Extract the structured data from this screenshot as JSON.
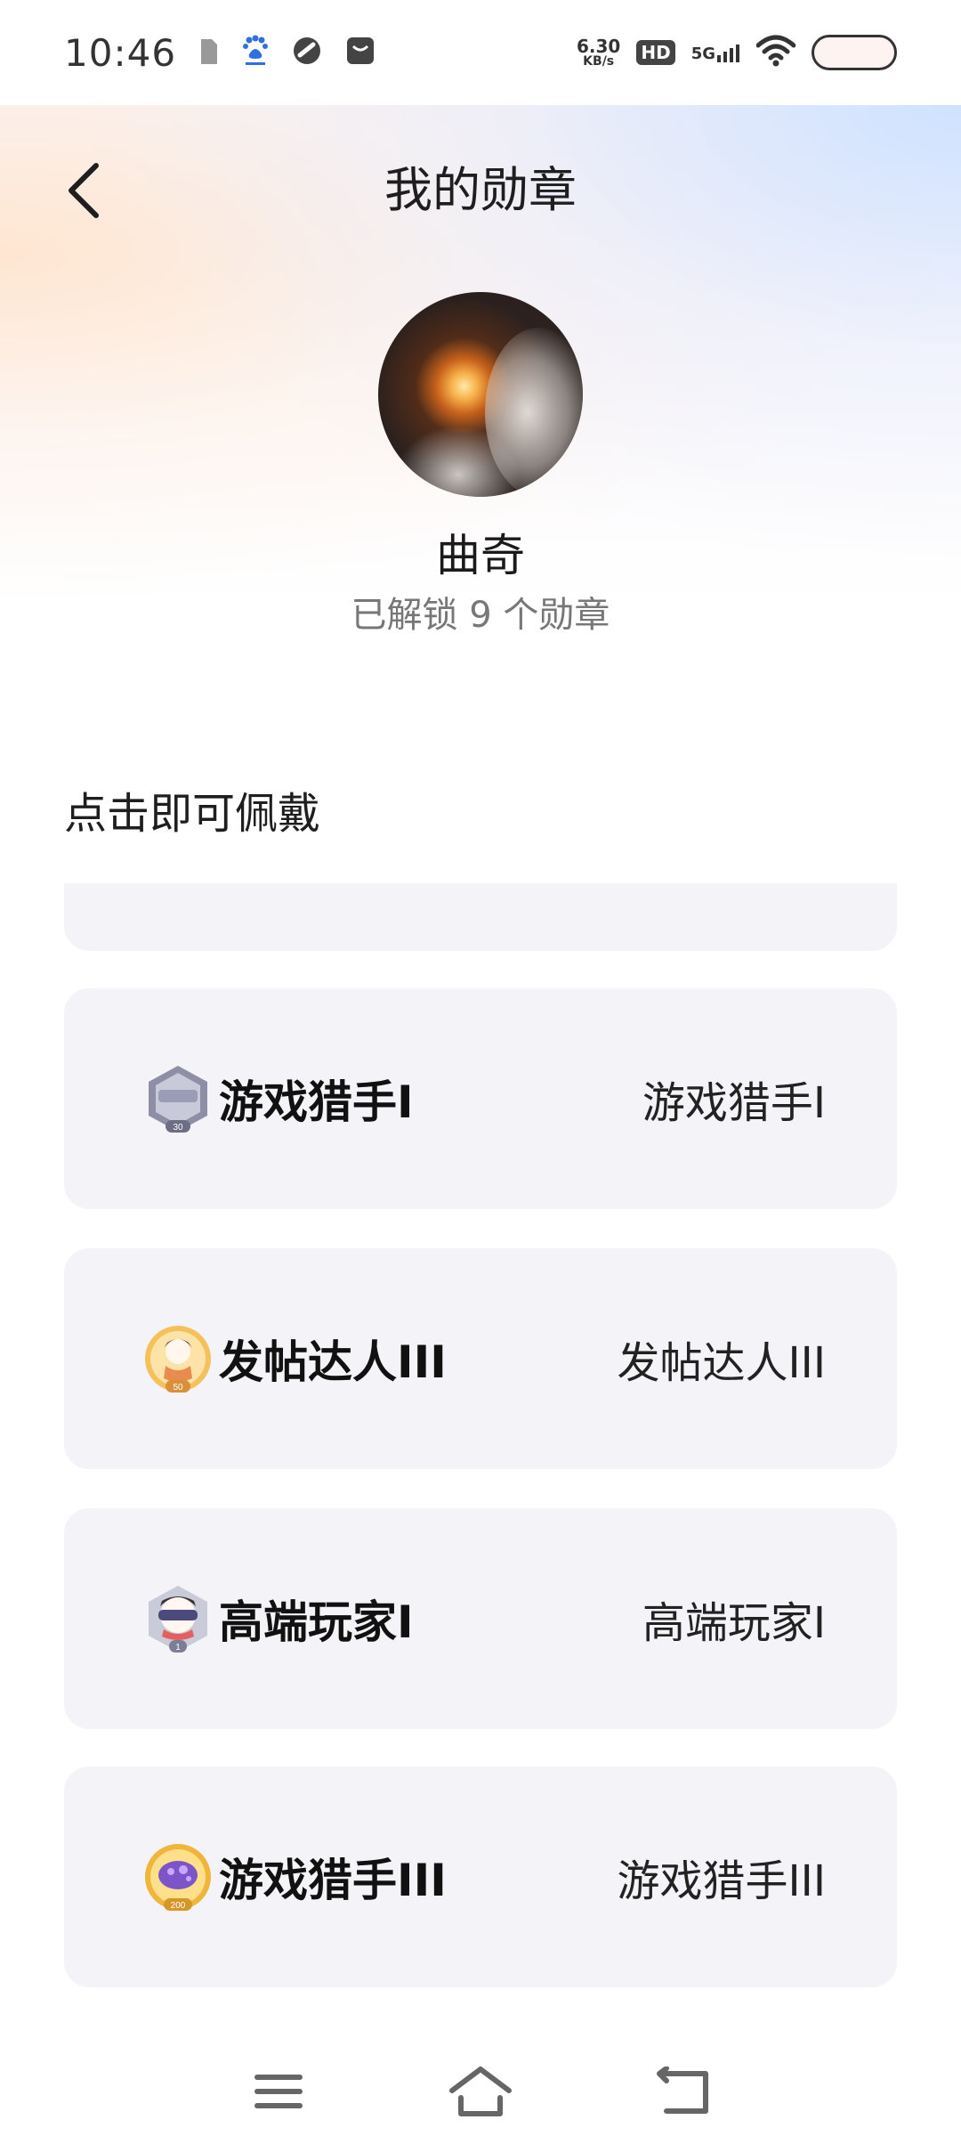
{
  "status_bar": {
    "time": "10:46",
    "net_speed_value": "6.30",
    "net_speed_unit": "KB/s",
    "hd_label": "HD",
    "signal_label": "5G",
    "left_icons": [
      "sim-icon",
      "baidu-paw-icon",
      "link-app-icon",
      "message-box-icon"
    ],
    "right_icons": [
      "hd-icon",
      "5g-signal-icon",
      "wifi-icon",
      "battery-icon"
    ]
  },
  "header": {
    "title": "我的勋章",
    "back_icon": "chevron-left-icon"
  },
  "profile": {
    "name": "曲奇",
    "unlock_text": "已解锁 9 个勋章"
  },
  "section": {
    "title": "点击即可佩戴"
  },
  "badges": [
    {
      "name": "游戏猎手I",
      "description": "游戏猎手I",
      "icon": "hexagon-level-30-badge-icon",
      "level": "30"
    },
    {
      "name": "发帖达人III",
      "description": "发帖达人III",
      "icon": "character-level-50-badge-icon",
      "level": "50"
    },
    {
      "name": "高端玩家I",
      "description": "高端玩家I",
      "icon": "vr-character-level-1-badge-icon",
      "level": "1"
    },
    {
      "name": "游戏猎手III",
      "description": "游戏猎手III",
      "icon": "gold-level-200-badge-icon",
      "level": "200"
    }
  ],
  "nav_bar": {
    "icons": [
      "menu-icon",
      "home-icon",
      "back-icon"
    ]
  },
  "colors": {
    "card_bg": "#f3f3f8",
    "muted_text": "#777777",
    "primary_text": "#111111"
  }
}
